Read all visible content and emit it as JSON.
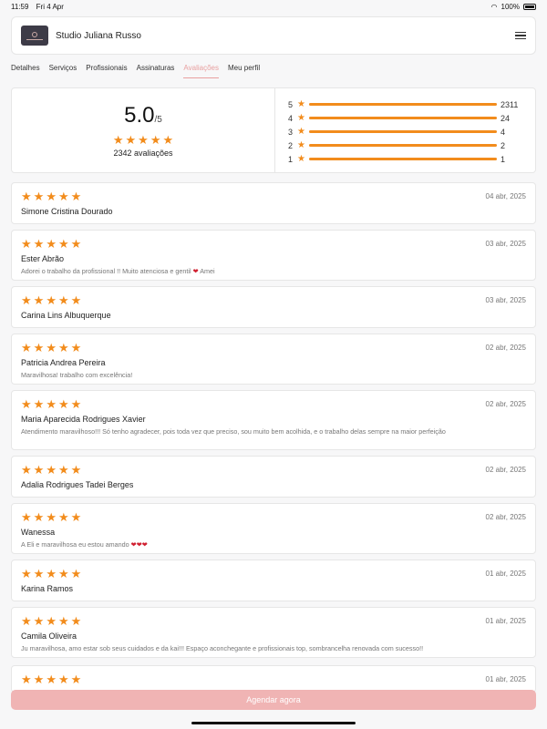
{
  "status_bar": {
    "time": "11:59",
    "date": "Fri 4 Apr",
    "battery": "100%"
  },
  "header": {
    "studio_name": "Studio Juliana Russo"
  },
  "tabs": [
    {
      "label": "Detalhes"
    },
    {
      "label": "Serviços"
    },
    {
      "label": "Profissionais"
    },
    {
      "label": "Assinaturas"
    },
    {
      "label": "Avaliações"
    },
    {
      "label": "Meu perfil"
    }
  ],
  "summary": {
    "score": "5.0",
    "out_of": "/5",
    "total_label": "2342 avaliações",
    "distribution": [
      {
        "stars": "5",
        "count": "2311",
        "fraction": 1.0
      },
      {
        "stars": "4",
        "count": "24",
        "fraction": 1.0
      },
      {
        "stars": "3",
        "count": "4",
        "fraction": 1.0
      },
      {
        "stars": "2",
        "count": "2",
        "fraction": 1.0
      },
      {
        "stars": "1",
        "count": "1",
        "fraction": 1.0
      }
    ]
  },
  "reviews": [
    {
      "name": "Simone Cristina Dourado",
      "date": "04 abr, 2025",
      "rating": 5,
      "comment": ""
    },
    {
      "name": "Ester Abrão",
      "date": "03 abr, 2025",
      "rating": 5,
      "comment": "Adorei o trabalho da profissional !! Muito atenciosa e gentil ❤️  Amei"
    },
    {
      "name": "Carina Lins Albuquerque",
      "date": "03 abr, 2025",
      "rating": 5,
      "comment": ""
    },
    {
      "name": "Patricia Andrea Pereira",
      "date": "02 abr, 2025",
      "rating": 5,
      "comment": "Maravilhosa! trabalho com excelência!"
    },
    {
      "name": "Maria Aparecida Rodrigues Xavier",
      "date": "02 abr, 2025",
      "rating": 5,
      "comment": "Atendimento maravilhoso!!! Só tenho agradecer, pois toda vez que preciso, sou muito bem acolhida, e o trabalho delas sempre na maior perfeição"
    },
    {
      "name": "Adalia Rodrigues Tadei Berges",
      "date": "02 abr, 2025",
      "rating": 5,
      "comment": ""
    },
    {
      "name": "Wanessa",
      "date": "02 abr, 2025",
      "rating": 5,
      "comment": "A Eli e maravilhosa eu estou amando ❤️❤️❤️"
    },
    {
      "name": "Karina Ramos",
      "date": "01 abr, 2025",
      "rating": 5,
      "comment": ""
    },
    {
      "name": "Camila Oliveira",
      "date": "01 abr, 2025",
      "rating": 5,
      "comment": "Ju maravilhosa, amo estar sob seus cuidados e da kai!!! Espaço aconchegante e profissionais top, sombrancelha renovada com sucesso!!"
    },
    {
      "name": "",
      "date": "01 abr, 2025",
      "rating": 5,
      "comment": ""
    }
  ],
  "cta": {
    "label": "Agendar agora"
  },
  "colors": {
    "star": "#f28c1c",
    "accent": "#e8a0a0",
    "cta_bg": "#f0b4b4"
  }
}
